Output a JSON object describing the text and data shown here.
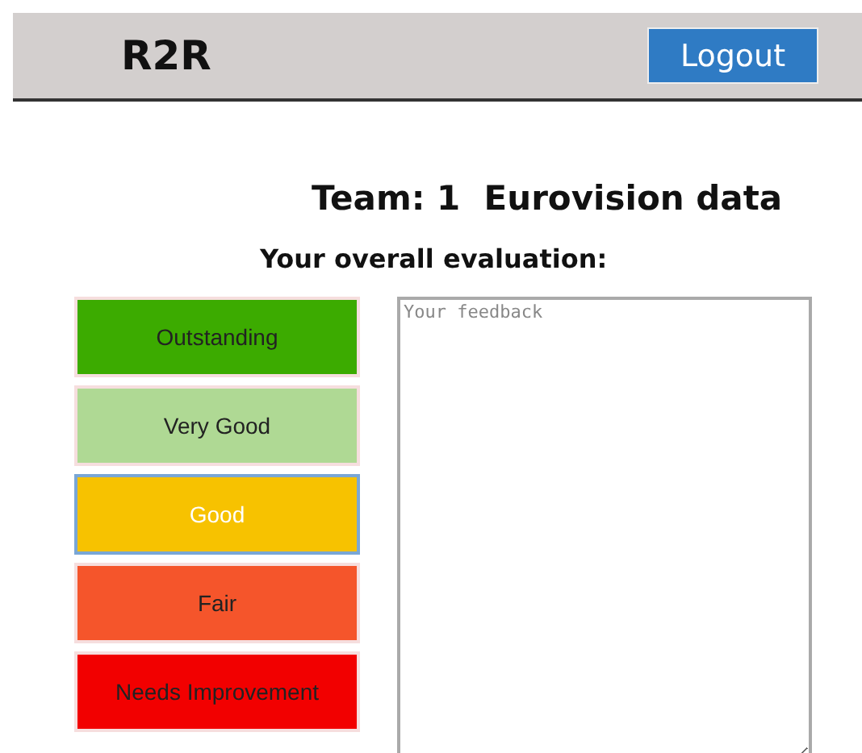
{
  "header": {
    "logo": "R2R",
    "logout_button": "Logout"
  },
  "title": "Team: 1  Eurovision data",
  "subtitle": "Your overall evaluation:",
  "ratings": [
    {
      "label": "Outstanding",
      "color": "#3cab00",
      "selected": false
    },
    {
      "label": "Very Good",
      "color": "#afd994",
      "selected": false
    },
    {
      "label": "Good",
      "color": "#f7c200",
      "selected": true
    },
    {
      "label": "Fair",
      "color": "#f5552b",
      "selected": false
    },
    {
      "label": "Needs Improvement",
      "color": "#f20000",
      "selected": false
    }
  ],
  "feedback": {
    "placeholder": "Your feedback"
  }
}
